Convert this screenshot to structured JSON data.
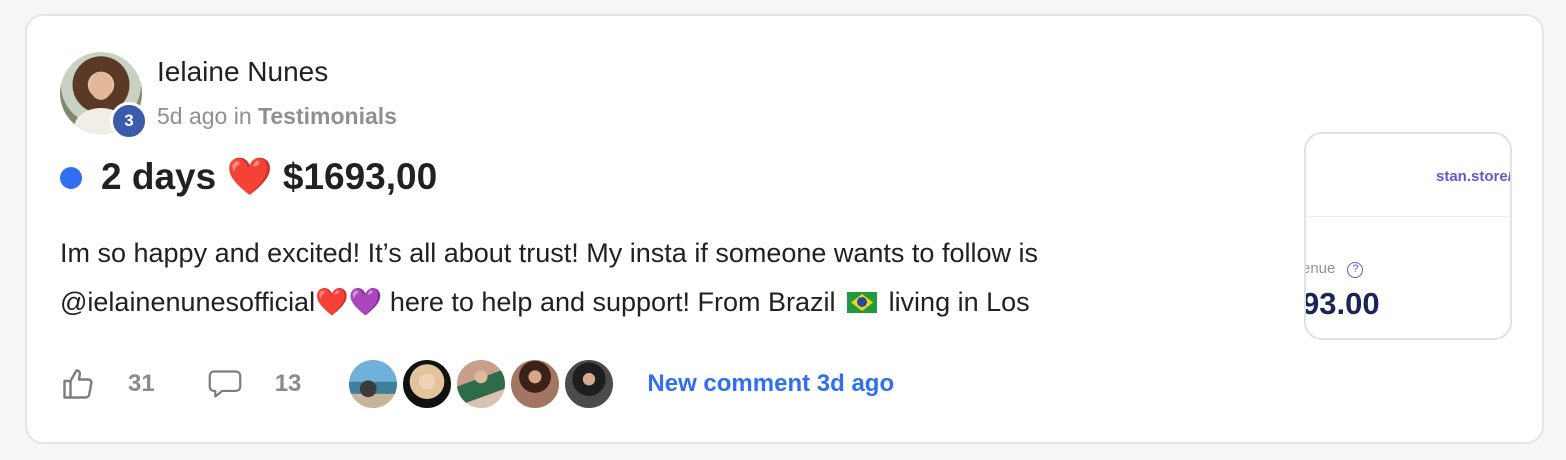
{
  "post": {
    "author": {
      "name": "Ielaine Nunes",
      "level": "3",
      "avatar_icon": "author-avatar"
    },
    "meta": {
      "time": "5d ago",
      "in_word": "in",
      "category": "Testimonials"
    },
    "title": {
      "part1": "2 days",
      "heart": "❤️",
      "part2": "$1693,00"
    },
    "body": {
      "line1": "Im so happy and excited! It’s all about trust! My insta if someone wants to follow is",
      "line2_handle": "@ielainenunesofficial",
      "line2_red_heart": "❤️",
      "line2_purple_heart": "💜",
      "line2_mid": " here to help and support! From Brazil ",
      "line2_end": " living in Los"
    },
    "actions": {
      "likes": "31",
      "comments": "13",
      "new_comment": "New comment 3d ago",
      "commenter_avatars": [
        "commenter-avatar-1",
        "commenter-avatar-2",
        "commenter-avatar-3",
        "commenter-avatar-4",
        "commenter-avatar-5"
      ]
    },
    "thumbnail": {
      "url_text": "stan.store/",
      "label": "enue",
      "help_glyph": "?",
      "value": "93.00"
    }
  },
  "colors": {
    "accent_blue": "#2f6ff0",
    "level_badge": "#3c5cab",
    "muted_text": "#909090"
  }
}
